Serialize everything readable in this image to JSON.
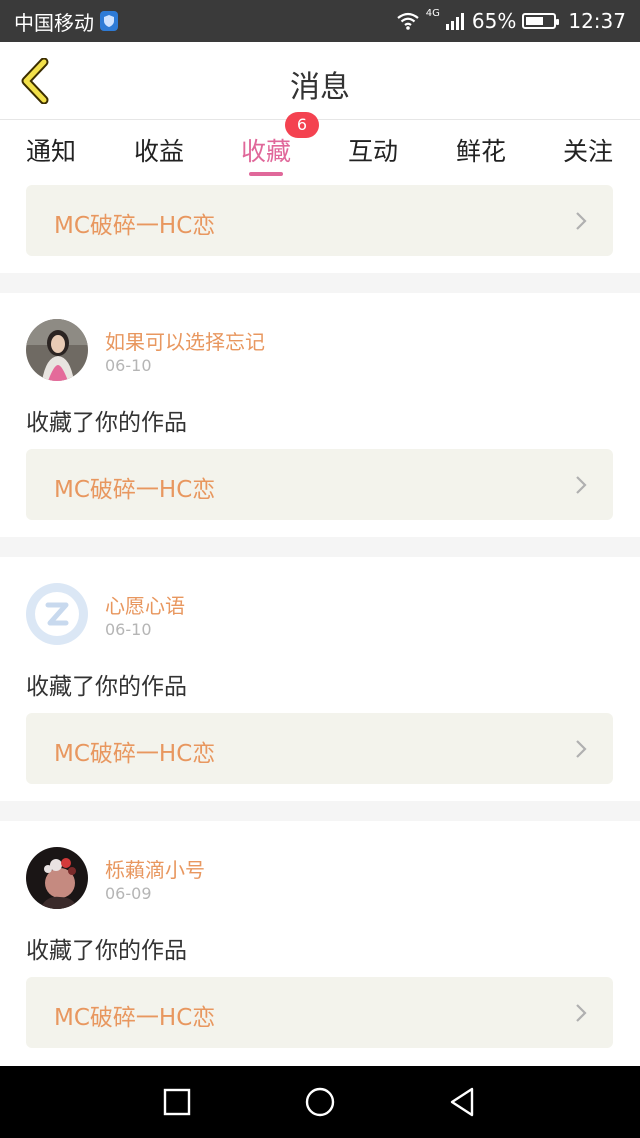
{
  "status_bar": {
    "carrier": "中国移动",
    "network": "4G",
    "battery_percent": "65%",
    "battery_level": 0.65,
    "time": "12:37",
    "icons": [
      "shield-icon",
      "wifi-icon",
      "signal-icon",
      "battery-icon"
    ]
  },
  "header": {
    "title": "消息",
    "back_icon": "chevron-left-icon"
  },
  "tabs": [
    {
      "label": "通知"
    },
    {
      "label": "收益"
    },
    {
      "label": "收藏",
      "active": true,
      "badge": "6"
    },
    {
      "label": "互动"
    },
    {
      "label": "鲜花"
    },
    {
      "label": "关注"
    }
  ],
  "colors": {
    "accent": "#e0689a",
    "username": "#e8975f",
    "badge": "#f44250",
    "work_bg": "#f3f3ec"
  },
  "items": [
    {
      "work_title": "MC破碎一HC恋"
    },
    {
      "username": "如果可以选择忘记",
      "date": "06-10",
      "message": "收藏了你的作品",
      "work_title": "MC破碎一HC恋",
      "avatar": "user-photo"
    },
    {
      "username": "心愿心语",
      "date": "06-10",
      "message": "收藏了你的作品",
      "work_title": "MC破碎一HC恋",
      "avatar": "default-avatar-icon"
    },
    {
      "username": "栎藾滴小号",
      "date": "06-09",
      "message": "收藏了你的作品",
      "work_title": "MC破碎一HC恋",
      "avatar": "user-photo"
    }
  ],
  "nav_bar": {
    "icons": [
      "square-icon",
      "circle-icon",
      "triangle-back-icon"
    ]
  }
}
